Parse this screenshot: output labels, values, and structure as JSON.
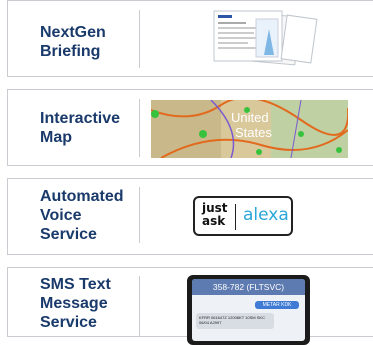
{
  "cards": [
    {
      "label_lines": [
        "NextGen",
        "Briefing"
      ]
    },
    {
      "label_lines": [
        "Interactive",
        "Map"
      ],
      "map_text": [
        "United",
        "States"
      ]
    },
    {
      "label_lines": [
        "Automated",
        "Voice",
        "Service"
      ],
      "badge": {
        "left_lines": [
          "just",
          "ask"
        ],
        "right": "alexa"
      }
    },
    {
      "label_lines": [
        "SMS Text",
        "Message",
        "Service"
      ],
      "phone": {
        "header": "358-782 (FLTSVC)",
        "sent": "METAR KDK",
        "received": "KFRR 061647Z 12008KT 10SM SKC 06/04 A2997"
      }
    }
  ],
  "colors": {
    "label": "#1a3a6b",
    "border": "#c9cdd2",
    "alexa": "#2aa6d8"
  },
  "icons": [
    "briefing-thumbnail",
    "map-thumbnail",
    "alexa-badge",
    "phone-sms"
  ]
}
